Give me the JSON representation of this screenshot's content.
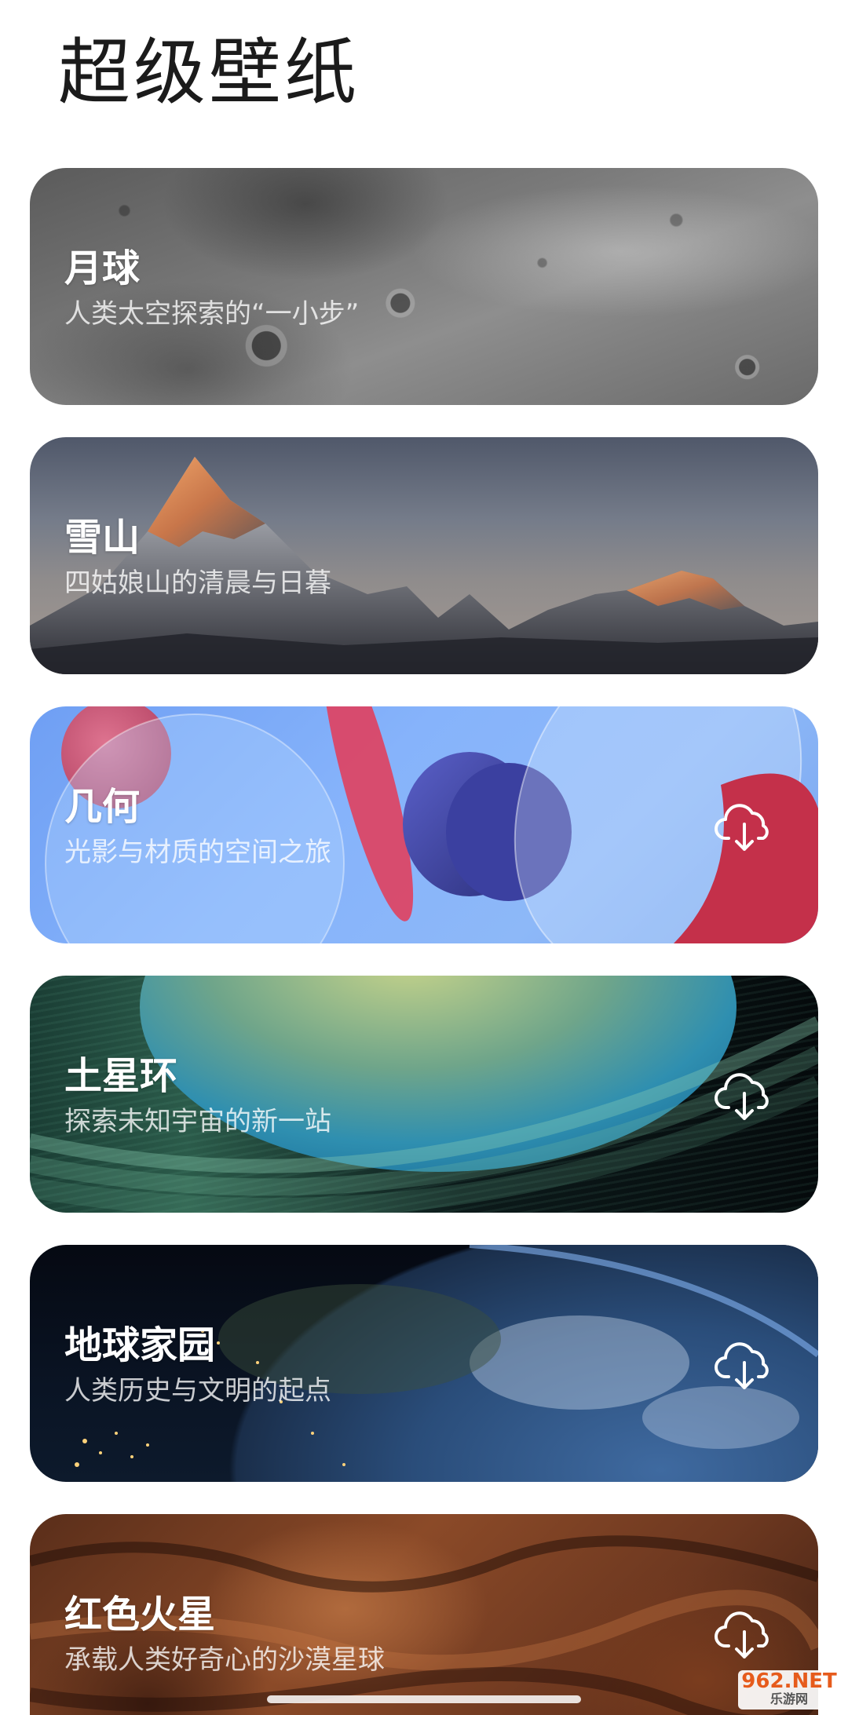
{
  "page_title": "超级壁纸",
  "cards": [
    {
      "name": "月球",
      "description": "人类太空探索的“一小步”",
      "downloadable": false
    },
    {
      "name": "雪山",
      "description": "四姑娘山的清晨与日暮",
      "downloadable": false
    },
    {
      "name": "几何",
      "description": "光影与材质的空间之旅",
      "downloadable": true
    },
    {
      "name": "土星环",
      "description": "探索未知宇宙的新一站",
      "downloadable": true
    },
    {
      "name": "地球家园",
      "description": "人类历史与文明的起点",
      "downloadable": true
    },
    {
      "name": "红色火星",
      "description": "承载人类好奇心的沙漠星球",
      "downloadable": true
    }
  ],
  "icons": {
    "download": "cloud-download-icon"
  },
  "watermark": {
    "main": "962.NET",
    "sub": "乐游网"
  }
}
